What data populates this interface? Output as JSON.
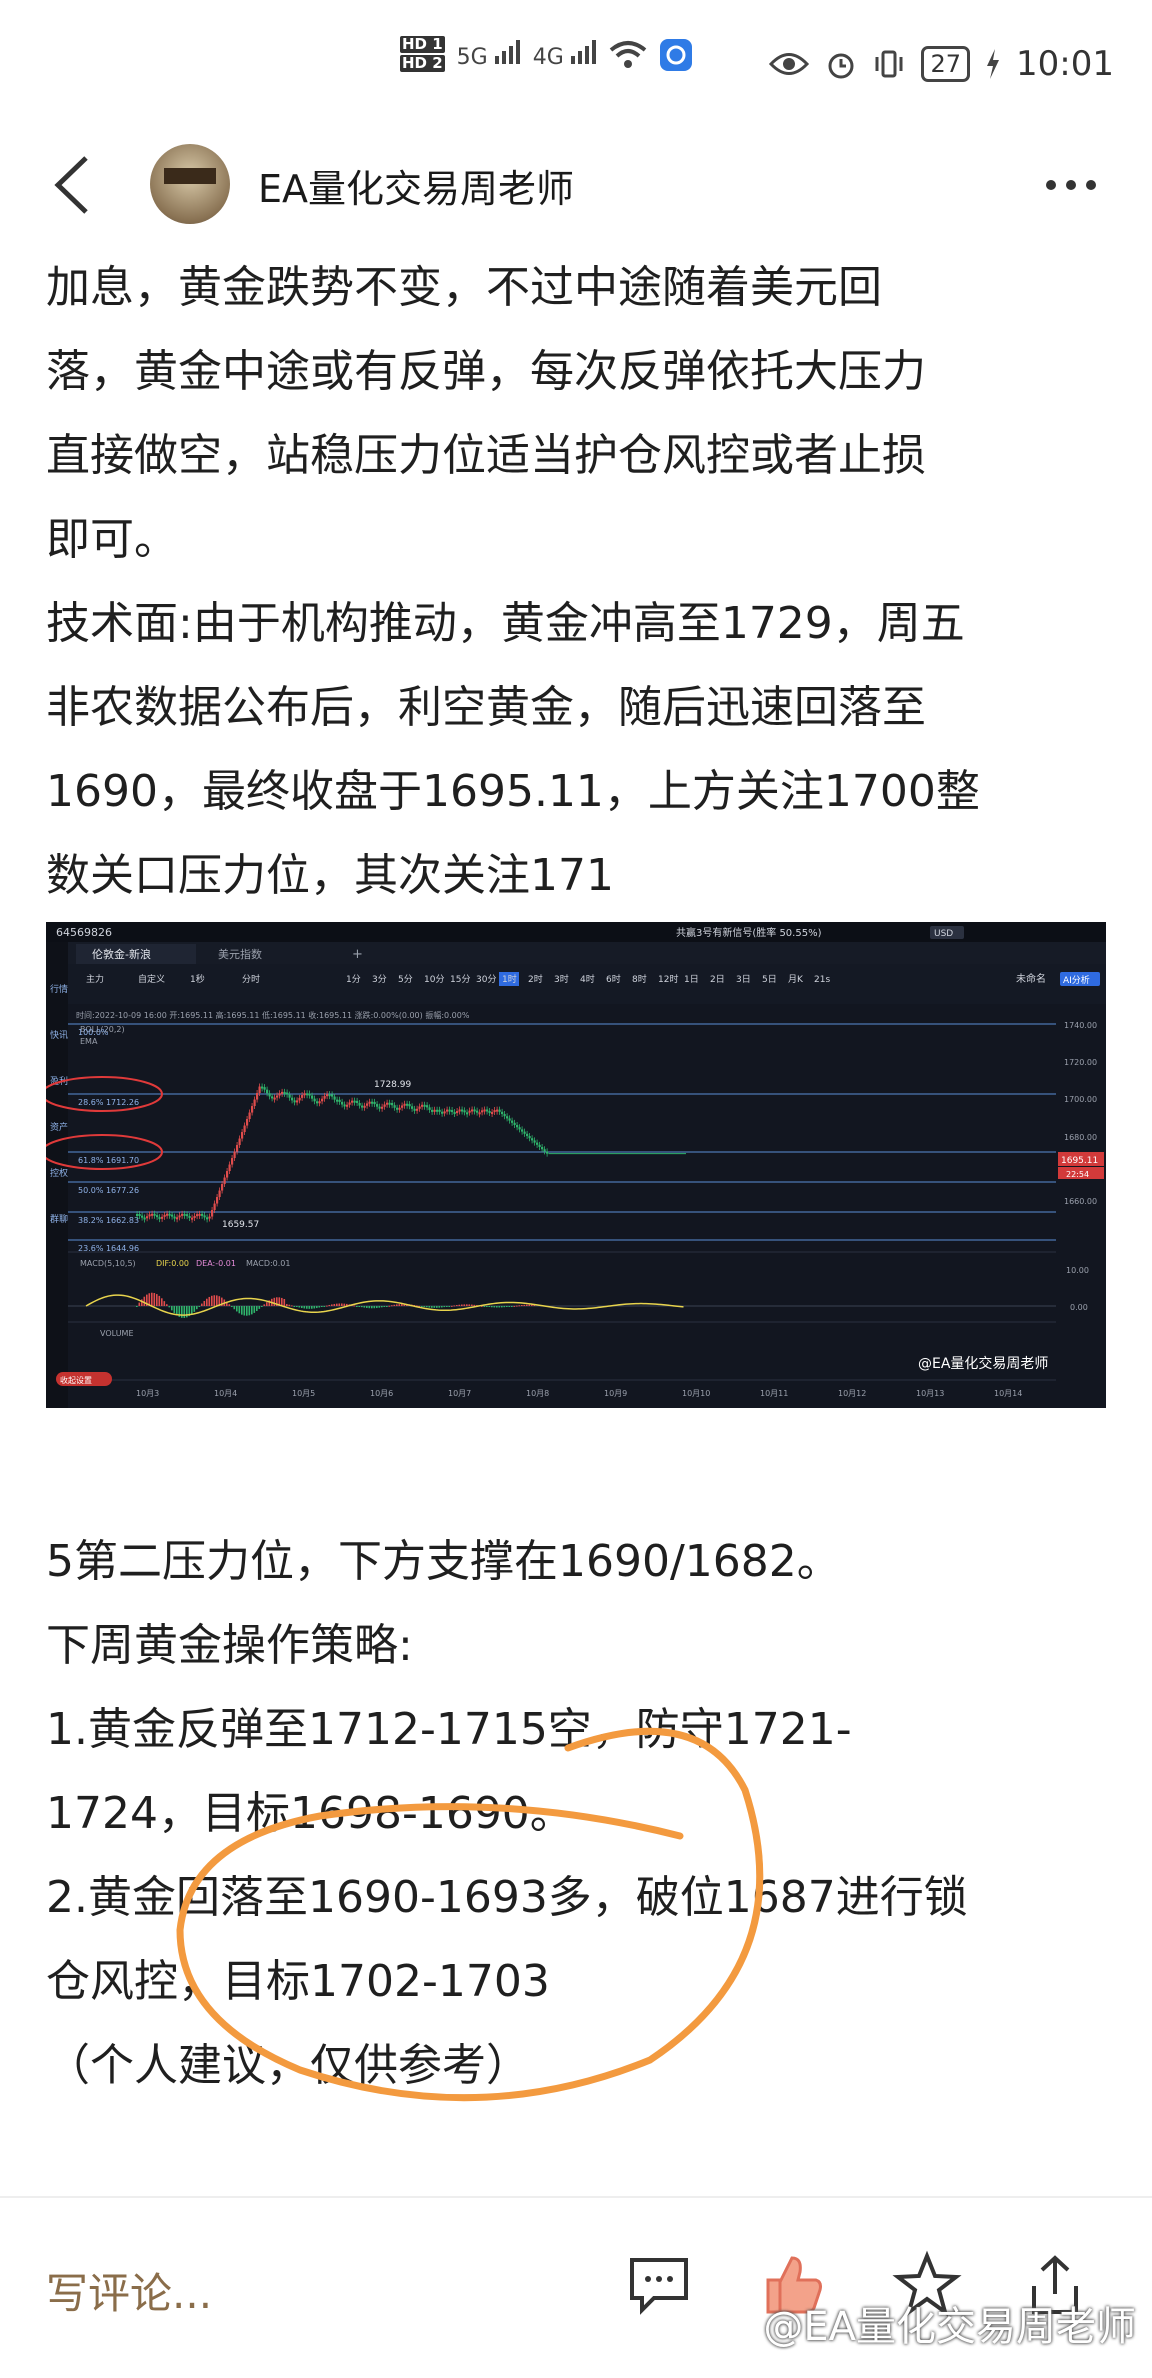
{
  "status_bar": {
    "hd1": "HD 1",
    "hd2": "HD 2",
    "sig1": "5G",
    "sig2": "4G",
    "battery": "27",
    "time": "10:01"
  },
  "header": {
    "author": "EA量化交易周老师"
  },
  "article": {
    "paragraphs": [
      "加息，黄金跌势不变，不过中途随着美元回",
      "落，黄金中途或有反弹，每次反弹依托大压力",
      "直接做空，站稳压力位适当护仓风控或者止损",
      "即可。",
      "技术面:由于机构推动，黄金冲高至1729，周五",
      "非农数据公布后，利空黄金，随后迅速回落至",
      "1690，最终收盘于1695.11，上方关注1700整",
      "数关口压力位，其次关注171"
    ]
  },
  "chart": {
    "account": "64569826",
    "title_right": "共赢3号有新信号(胜率 50.55%)",
    "currency": "USD",
    "tab_active": "伦敦金-新浪",
    "tab_other": "美元指数",
    "tab_add": "+",
    "side_nav": [
      "行情",
      "快讯",
      "盈利",
      "资产",
      "控权",
      "群聊"
    ],
    "toolbar_left": [
      "主力",
      "自定义",
      "1秒",
      "分时"
    ],
    "timeframes": [
      "1分",
      "3分",
      "5分",
      "10分",
      "15分",
      "30分",
      "1时",
      "2时",
      "3时",
      "4时",
      "6时",
      "8时",
      "12时",
      "1日",
      "2日",
      "3日",
      "5日",
      "月K",
      "21s"
    ],
    "toolbar_right": "未命名",
    "toolbar_badge": "AI分析",
    "ohlc": "时间:2022-10-09 16:00  开:1695.11  高:1695.11  低:1695.11  收:1695.11  涨跌:0.00%(0.00)  振幅:0.00%",
    "boll_label": "BOLL(20,2)",
    "ema_label": "EMA",
    "fib_labels": [
      "100.0%",
      "28.6% 1712.26",
      "61.8% 1691.70",
      "50.0% 1677.26",
      "38.2% 1662.83",
      "23.6% 1644.96"
    ],
    "y_labels": [
      "1740.00",
      "1720.00",
      "1700.00",
      "1680.00",
      "1660.00"
    ],
    "price_tag": "1695.11",
    "time_tag": "22:54",
    "high_label": "1728.99",
    "low_label": "1659.57",
    "macd_label": "MACD(5,10,5)",
    "dif": "DIF:0.00",
    "dea": "DEA:-0.01",
    "macd": "MACD:0.01",
    "macd_y": [
      "10.00",
      "0.00"
    ],
    "volume_label": "VOLUME",
    "x_labels": [
      "10月3",
      "10月4",
      "10月5",
      "10月6",
      "10月7",
      "10月8",
      "10月9",
      "10月10",
      "10月11",
      "10月12",
      "10月13",
      "10月14"
    ],
    "bottom_left": "收起设置",
    "watermark": "@EA量化交易周老师"
  },
  "section2": {
    "paragraphs": [
      "5第二压力位，下方支撑在1690/1682。",
      "下周黄金操作策略:",
      "1.黄金反弹至1712-1715空，防守1721-",
      "1724，目标1698-1690。",
      "2.黄金回落至1690-1693多，破位1687进行锁",
      "仓风控，目标1702-1703",
      "（个人建议，仅供参考）"
    ]
  },
  "bottom_bar": {
    "comment_placeholder": "写评论...",
    "watermark": "@EA量化交易周老师"
  },
  "colors": {
    "annotation": "#f39a3f",
    "chart_bg": "#121620",
    "comment": "#8a6d4a"
  }
}
